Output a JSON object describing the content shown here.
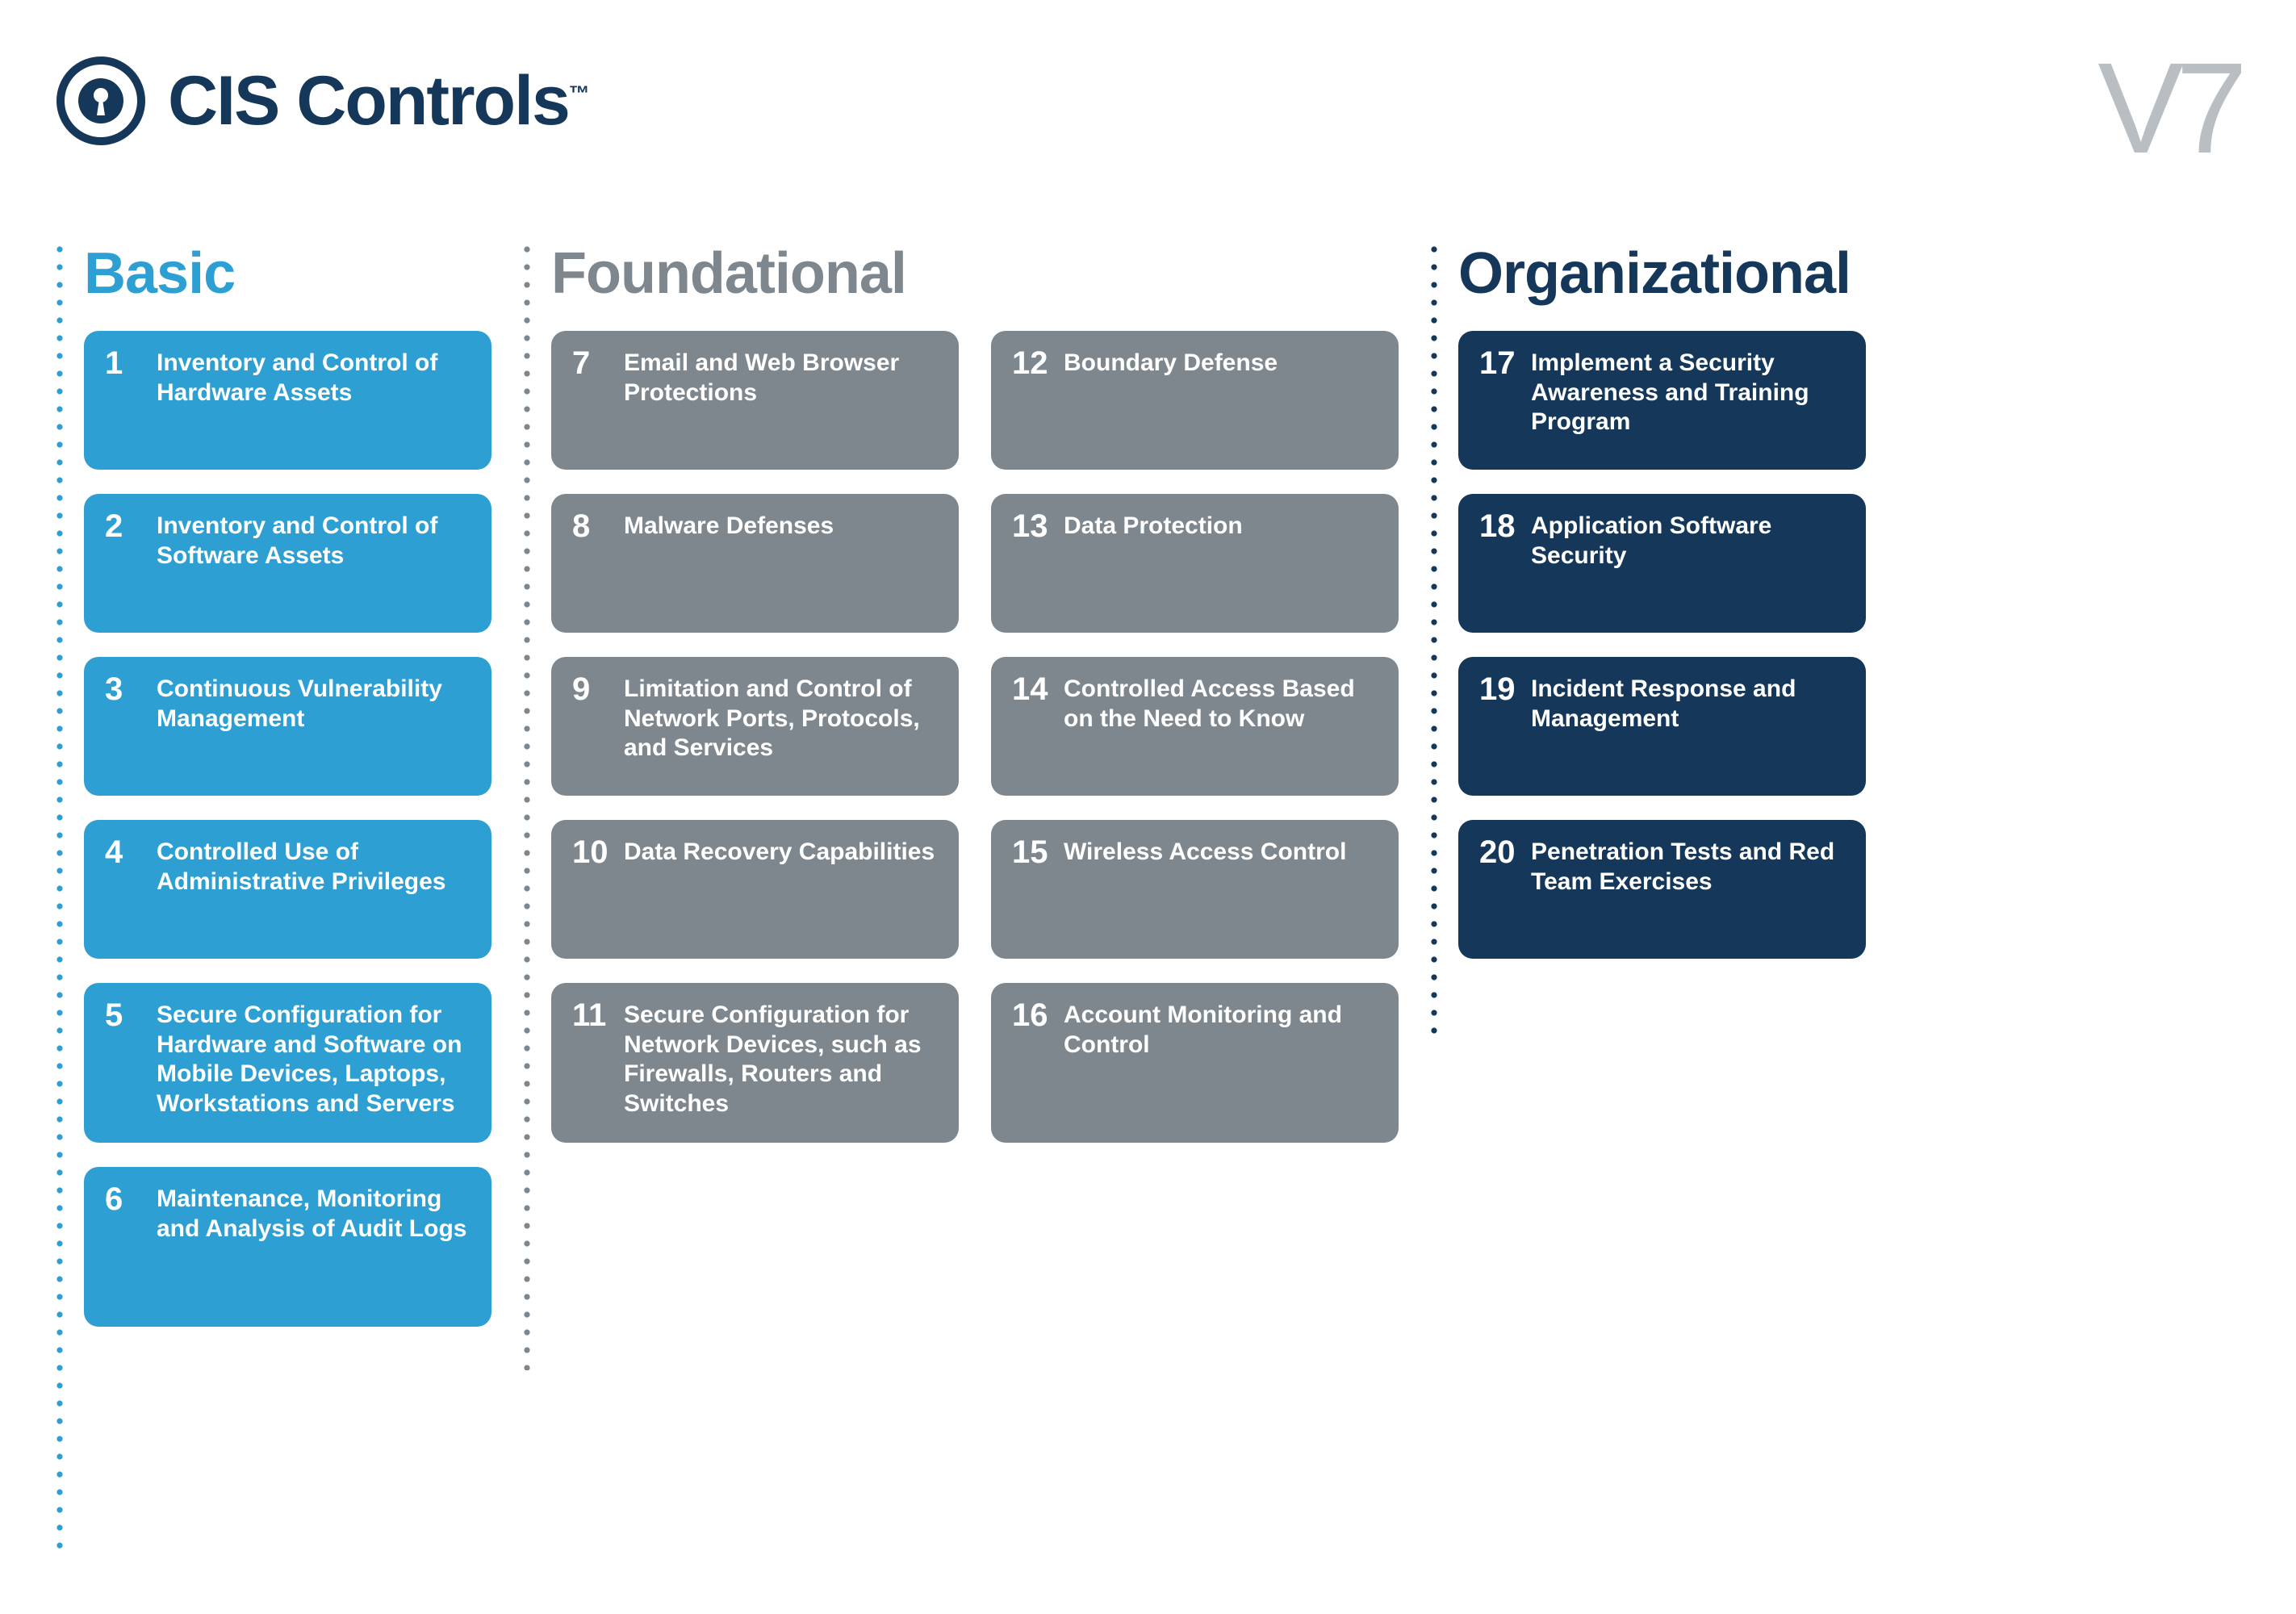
{
  "brand": {
    "title": "CIS Controls",
    "tm": "™"
  },
  "version": "V7",
  "columns": {
    "basic": {
      "title": "Basic",
      "items": [
        {
          "num": "1",
          "label": "Inventory and Control of Hardware Assets"
        },
        {
          "num": "2",
          "label": "Inventory and Control of Software Assets"
        },
        {
          "num": "3",
          "label": "Continuous Vulnerability Management"
        },
        {
          "num": "4",
          "label": "Controlled Use of Administrative Privileges"
        },
        {
          "num": "5",
          "label": "Secure Configuration for Hardware and Software on Mobile Devices, Laptops, Workstations and Servers"
        },
        {
          "num": "6",
          "label": "Maintenance, Monitoring and Analysis of Audit Logs"
        }
      ]
    },
    "foundational": {
      "title": "Foundational",
      "left": [
        {
          "num": "7",
          "label": "Email and Web Browser Protections"
        },
        {
          "num": "8",
          "label": "Malware Defenses"
        },
        {
          "num": "9",
          "label": "Limitation and Control of Network Ports, Protocols, and Services"
        },
        {
          "num": "10",
          "label": "Data Recovery Capabilities"
        },
        {
          "num": "11",
          "label": "Secure Configuration for Network Devices, such as Firewalls, Routers and Switches"
        }
      ],
      "right": [
        {
          "num": "12",
          "label": "Boundary Defense"
        },
        {
          "num": "13",
          "label": "Data Protection"
        },
        {
          "num": "14",
          "label": "Controlled Access Based on the Need to Know"
        },
        {
          "num": "15",
          "label": "Wireless Access Control"
        },
        {
          "num": "16",
          "label": "Account Monitoring and Control"
        }
      ]
    },
    "organizational": {
      "title": "Organizational",
      "items": [
        {
          "num": "17",
          "label": "Implement a Security Awareness and Training Program"
        },
        {
          "num": "18",
          "label": "Application Software Security"
        },
        {
          "num": "19",
          "label": "Incident Response and Management"
        },
        {
          "num": "20",
          "label": "Penetration Tests and Red Team Exercises"
        }
      ]
    }
  }
}
